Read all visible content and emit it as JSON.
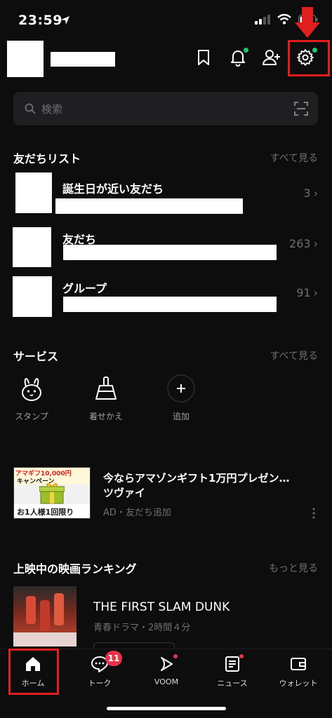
{
  "status_bar": {
    "time": "23:59"
  },
  "header": {
    "icons": [
      "bookmark-icon",
      "bell-icon",
      "add-friend-icon",
      "settings-icon"
    ]
  },
  "search": {
    "placeholder": "検索"
  },
  "friends_section": {
    "title": "友だちリスト",
    "see_all": "すべて見る",
    "rows": [
      {
        "label": "誕生日が近い友だち",
        "count": "3"
      },
      {
        "label": "友だち",
        "count": "263"
      },
      {
        "label": "グループ",
        "count": "91"
      }
    ]
  },
  "services_section": {
    "title": "サービス",
    "see_all": "すべて見る",
    "items": [
      {
        "label": "スタンプ",
        "icon": "rabbit-sticker-icon"
      },
      {
        "label": "着せかえ",
        "icon": "brush-icon"
      },
      {
        "label": "追加",
        "icon": "plus-icon"
      }
    ]
  },
  "ad": {
    "image_text_1": "アマギフ10,000円",
    "image_text_2": "キャンペーン",
    "image_text_3": "お1人様1回限り",
    "title": "今ならアマゾンギフト1万円プレゼン…",
    "title2": "ツヴァイ",
    "subtitle": "AD・友だち追加"
  },
  "movie_section": {
    "title": "上映中の映画ランキング",
    "see_more": "もっと見る",
    "movie_title": "THE FIRST SLAM DUNK",
    "movie_meta": "青春ドラマ・2時間４分"
  },
  "tabbar": {
    "tabs": [
      {
        "label": "ホーム",
        "icon": "home-icon"
      },
      {
        "label": "トーク",
        "icon": "chat-icon",
        "badge": "11"
      },
      {
        "label": "VOOM",
        "icon": "voom-icon"
      },
      {
        "label": "ニュース",
        "icon": "news-icon"
      },
      {
        "label": "ウォレット",
        "icon": "wallet-icon"
      }
    ]
  },
  "colors": {
    "background": "#0d0d0d",
    "accent_green": "#1ec771",
    "annotation_red": "#e01e1e",
    "badge_red": "#e8334a"
  }
}
